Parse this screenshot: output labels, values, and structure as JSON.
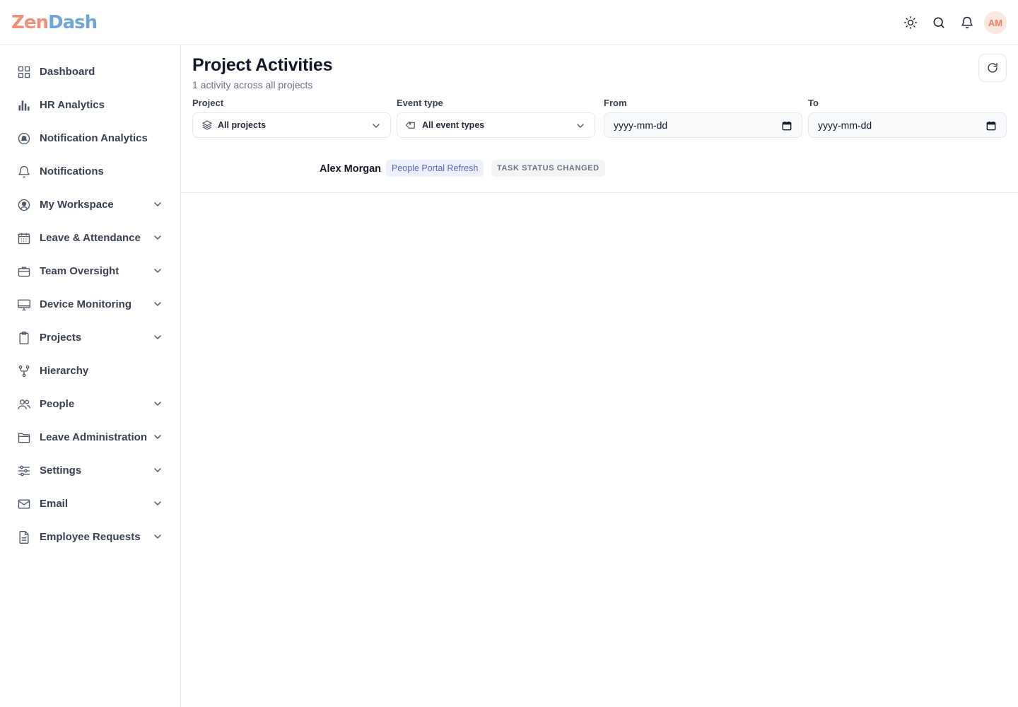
{
  "app": {
    "logo_part1": "Zen",
    "logo_part2": "Dash",
    "avatar_initials": "AM",
    "icons": [
      "sun-icon",
      "search-icon",
      "bell-icon"
    ]
  },
  "sidebar": {
    "items": [
      {
        "label": "Dashboard",
        "icon": "grid-icon",
        "expandable": false
      },
      {
        "label": "HR Analytics",
        "icon": "bar-chart-icon",
        "expandable": false
      },
      {
        "label": "Notification Analytics",
        "icon": "notification-analytics-icon",
        "expandable": false
      },
      {
        "label": "Notifications",
        "icon": "bell-icon",
        "expandable": false
      },
      {
        "label": "My Workspace",
        "icon": "user-circle-icon",
        "expandable": true
      },
      {
        "label": "Leave & Attendance",
        "icon": "calendar-icon",
        "expandable": true
      },
      {
        "label": "Team Oversight",
        "icon": "briefcase-icon",
        "expandable": true
      },
      {
        "label": "Device Monitoring",
        "icon": "monitor-icon",
        "expandable": true
      },
      {
        "label": "Projects",
        "icon": "clipboard-icon",
        "expandable": true
      },
      {
        "label": "Hierarchy",
        "icon": "hierarchy-icon",
        "expandable": false
      },
      {
        "label": "People",
        "icon": "users-icon",
        "expandable": true
      },
      {
        "label": "Leave Administration",
        "icon": "folder-icon",
        "expandable": true
      },
      {
        "label": "Settings",
        "icon": "sliders-icon",
        "expandable": true
      },
      {
        "label": "Email",
        "icon": "mail-icon",
        "expandable": true
      },
      {
        "label": "Employee Requests",
        "icon": "document-icon",
        "expandable": true
      }
    ]
  },
  "page": {
    "title": "Project Activities",
    "subtitle": "1 activity across all projects"
  },
  "filters": {
    "project": {
      "label": "Project",
      "value": "All projects"
    },
    "event_type": {
      "label": "Event type",
      "value": "All event types"
    },
    "from": {
      "label": "From",
      "placeholder": "yyyy-mm-dd"
    },
    "to": {
      "label": "To",
      "placeholder": "yyyy-mm-dd"
    }
  },
  "activities": [
    {
      "user": "Alex Morgan",
      "project": "People Portal Refresh",
      "event": "TASK STATUS CHANGED"
    }
  ]
}
